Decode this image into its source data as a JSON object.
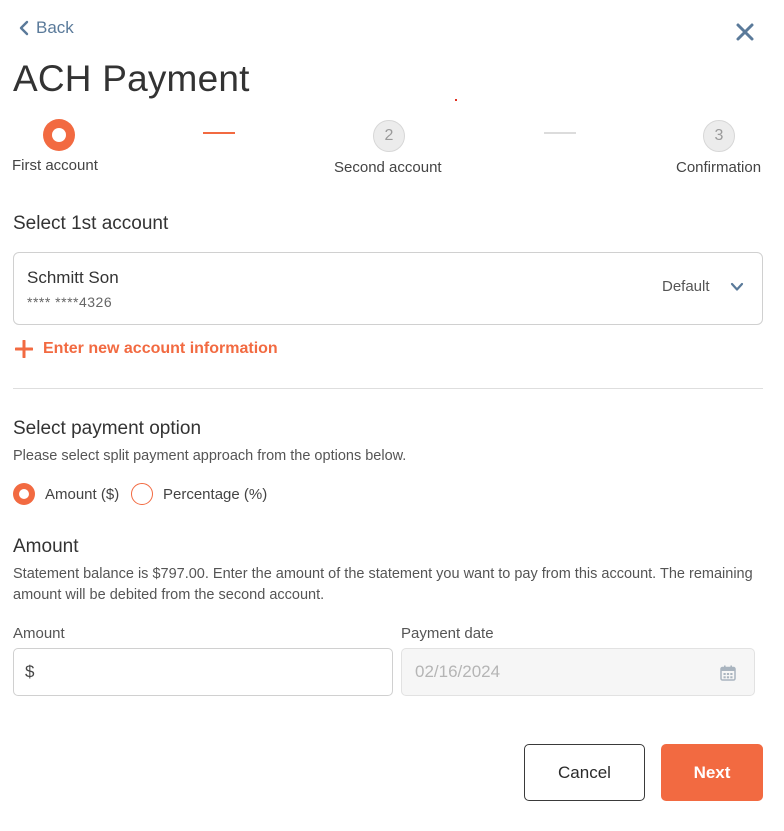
{
  "header": {
    "back_label": "Back",
    "title": "ACH Payment"
  },
  "stepper": {
    "steps": [
      {
        "label": "First account",
        "number": "1",
        "state": "active"
      },
      {
        "label": "Second account",
        "number": "2",
        "state": "pending"
      },
      {
        "label": "Confirmation",
        "number": "3",
        "state": "pending"
      }
    ]
  },
  "account_section": {
    "heading": "Select 1st account",
    "selected_account": {
      "name": "Schmitt Son",
      "masked_number": "**** ****4326",
      "badge": "Default"
    },
    "new_account_link": "Enter new account information"
  },
  "payment_option": {
    "heading": "Select payment option",
    "description": "Please select split payment approach from the options below.",
    "options": [
      {
        "label": "Amount ($)",
        "selected": true
      },
      {
        "label": "Percentage (%)",
        "selected": false
      }
    ]
  },
  "amount_section": {
    "heading": "Amount",
    "description": "Statement balance is $797.00. Enter the amount of the statement you want to pay from this account. The remaining amount will be debited from the second account.",
    "amount_label": "Amount",
    "amount_prefix": "$",
    "amount_value": "",
    "date_label": "Payment date",
    "date_value": "02/16/2024"
  },
  "actions": {
    "cancel_label": "Cancel",
    "next_label": "Next"
  },
  "colors": {
    "accent": "#f26a41",
    "link_blue": "#5a7a9a"
  }
}
